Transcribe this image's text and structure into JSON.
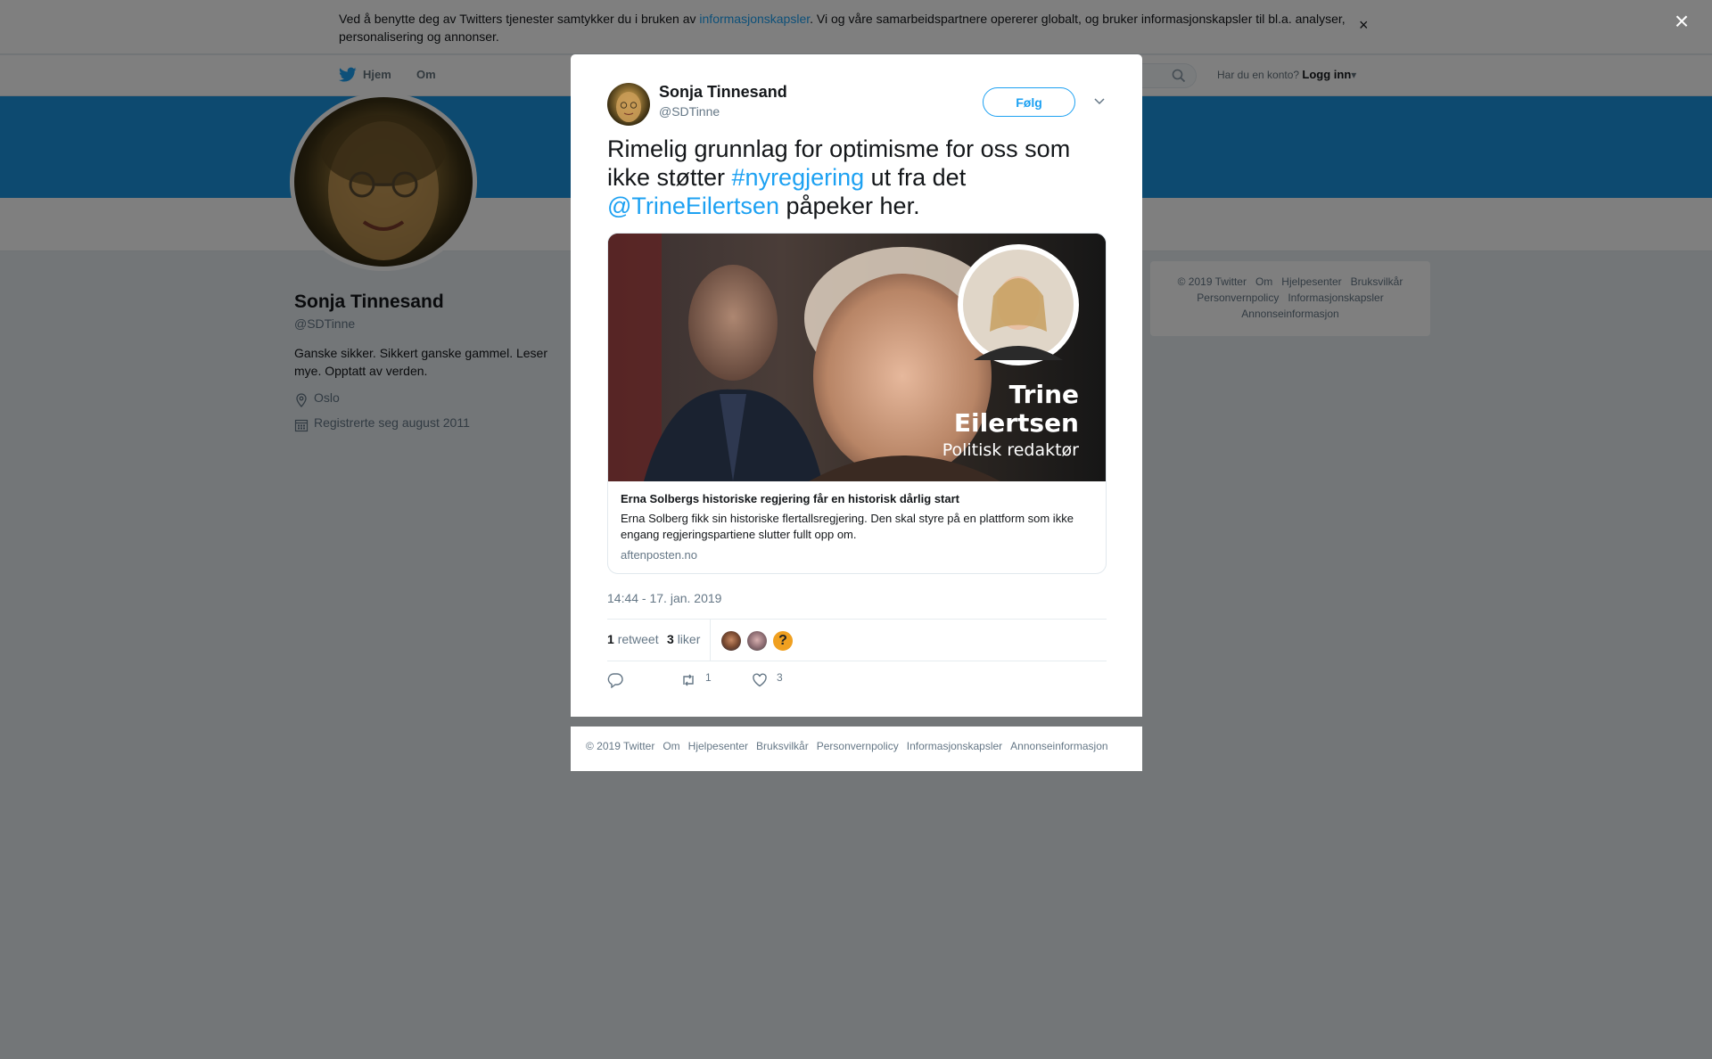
{
  "cookie_banner": {
    "text_before": "Ved å benytte deg av Twitters tjenester samtykker du i bruken av ",
    "link": "informasjonskapsler",
    "text_after": ". Vi og våre samarbeidspartnere opererer globalt, og bruker informasjonskapsler til bl.a. analyser, personalisering og annonser.",
    "close_glyph": "×"
  },
  "nav": {
    "home": "Hjem",
    "about": "Om",
    "account_prompt": "Har du en konto?",
    "login": "Logg inn"
  },
  "profile": {
    "name": "Sonja Tinnesand",
    "handle": "@SDTinne",
    "bio": "Ganske sikker. Sikkert ganske gammel. Leser mye. Opptatt av verden.",
    "location": "Oslo",
    "joined": "Registrerte seg august 2011"
  },
  "side_footer": {
    "items": [
      "© 2019 Twitter",
      "Om",
      "Hjelpesenter",
      "Bruksvilkår",
      "Personvernpolicy",
      "Informasjonskapsler",
      "Annonseinformasjon"
    ]
  },
  "overlay": {
    "close_glyph": "×"
  },
  "tweet": {
    "author_name": "Sonja Tinnesand",
    "author_handle": "@SDTinne",
    "follow_label": "Følg",
    "text_1": "Rimelig grunnlag for optimisme for oss som ikke støtter ",
    "hashtag": "#nyregjering",
    "text_2": " ut fra det ",
    "mention": "@TrineEilertsen",
    "text_3": " påpeker her.",
    "card": {
      "image_name_line1": "Trine",
      "image_name_line2": "Eilertsen",
      "image_role": "Politisk redaktør",
      "title": "Erna Solbergs historiske regjering får en historisk dårlig start",
      "description": "Erna Solberg fikk sin historiske flertallsregjering. Den skal styre på en plattform som ikke engang regjeringspartiene slutter fullt opp om.",
      "domain": "aftenposten.no"
    },
    "timestamp": "14:44 - 17. jan. 2019",
    "retweets": "1",
    "retweets_label": "retweet",
    "likes": "3",
    "likes_label": "liker",
    "liker_3_glyph": "?",
    "action_retweet_count": "1",
    "action_like_count": "3"
  },
  "modal_footer": {
    "items": [
      "© 2019 Twitter",
      "Om",
      "Hjelpesenter",
      "Bruksvilkår",
      "Personvernpolicy",
      "Informasjonskapsler",
      "Annonseinformasjon"
    ]
  },
  "colors": {
    "accent": "#1da1f2",
    "banner": "#1b95e0",
    "overlay": "rgba(0,0,0,0.5)"
  }
}
